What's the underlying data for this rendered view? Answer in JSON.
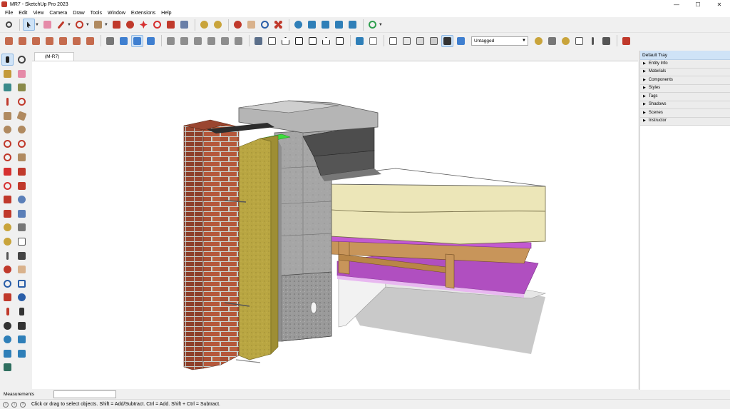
{
  "window": {
    "title": "MR7 - SketchUp Pro 2023"
  },
  "menu": [
    "File",
    "Edit",
    "View",
    "Camera",
    "Draw",
    "Tools",
    "Window",
    "Extensions",
    "Help"
  ],
  "toolbar": {
    "tag_select_value": "Untagged"
  },
  "scene_tab": "(M-R7)",
  "tray": {
    "title": "Default Tray",
    "panels": [
      "Entity Info",
      "Materials",
      "Components",
      "Styles",
      "Tags",
      "Shadows",
      "Scenes",
      "Instructor"
    ]
  },
  "measurements": {
    "label": "Measurements",
    "value": ""
  },
  "status": {
    "text": "Click or drag to select objects. Shift = Add/Subtract. Ctrl = Add. Shift + Ctrl = Subtract."
  },
  "colors": {
    "selection": "#cfe3f7",
    "brick": "#b5583b",
    "insulation_mineral_wool": "#b9a642",
    "insulation_board": "#ece6b8",
    "vapour_layer": "#b04fc0",
    "timber": "#c8955a",
    "concrete_block": "#a9a9a9",
    "coping": "#b5b5b5",
    "flashing_green": "#3fdc3f"
  }
}
